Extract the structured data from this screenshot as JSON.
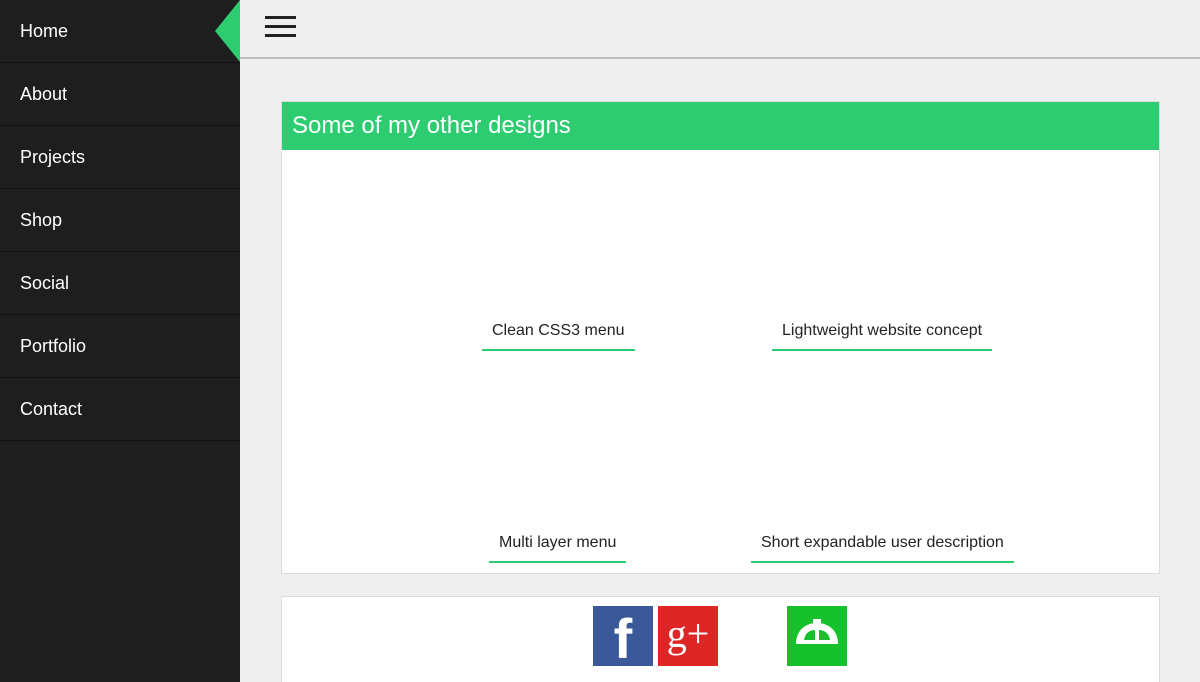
{
  "sidebar": {
    "items": [
      {
        "label": "Home",
        "active": true
      },
      {
        "label": "About"
      },
      {
        "label": "Projects"
      },
      {
        "label": "Shop"
      },
      {
        "label": "Social"
      },
      {
        "label": "Portfolio"
      },
      {
        "label": "Contact"
      }
    ]
  },
  "topbar": {
    "menu_icon": "hamburger-icon"
  },
  "designs": {
    "title": "Some of my other designs",
    "items": [
      {
        "label": "Clean CSS3 menu"
      },
      {
        "label": "Lightweight website concept"
      },
      {
        "label": "Multi layer menu"
      },
      {
        "label": "Short expandable user description"
      }
    ]
  },
  "social": {
    "facebook": {
      "icon": "facebook-icon",
      "glyph": "f",
      "color": "#3b5998"
    },
    "google_plus": {
      "icon": "google-plus-icon",
      "glyph": "g+",
      "color": "#dd2726"
    },
    "deviantart": {
      "icon": "deviantart-icon",
      "color": "#17c12c"
    }
  },
  "colors": {
    "accent": "#2ecc71",
    "sidebar_bg": "#1e1e1e",
    "page_bg": "#efefef"
  }
}
